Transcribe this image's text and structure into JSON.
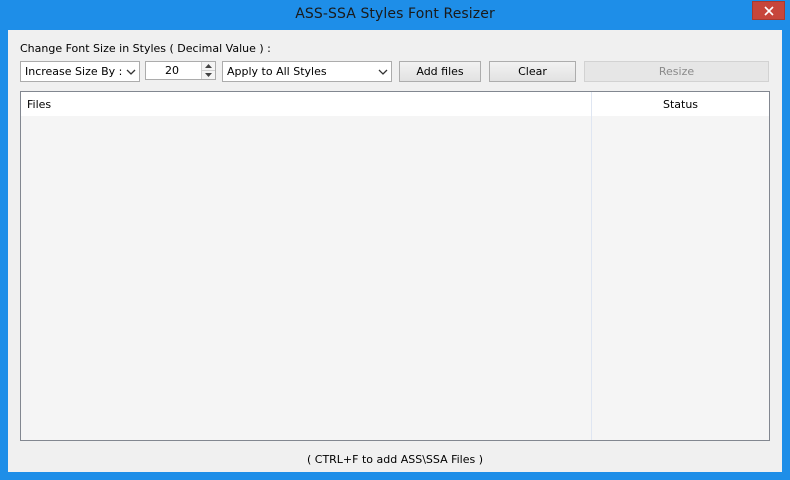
{
  "window": {
    "title": "ASS-SSA Styles Font Resizer"
  },
  "colors": {
    "titlebar": "#1e8ee8",
    "close_button": "#c7463b"
  },
  "controls": {
    "group_label": "Change Font Size in Styles ( Decimal Value ) :",
    "mode_select": "Increase Size By :",
    "size_value": "20",
    "scope_select": "Apply to All Styles",
    "add_files_label": "Add files",
    "clear_label": "Clear",
    "resize_label": "Resize"
  },
  "file_list": {
    "columns": [
      "Files",
      "Status"
    ],
    "rows": []
  },
  "footer": {
    "hint": "( CTRL+F to add ASS\\SSA Files )"
  }
}
